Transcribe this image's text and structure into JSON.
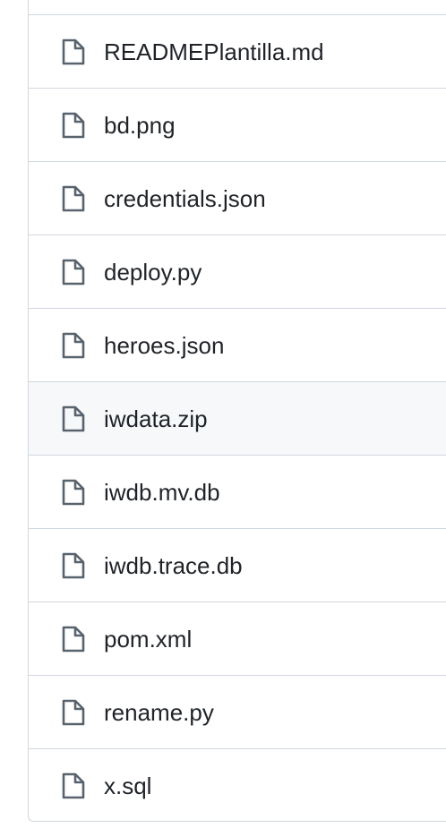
{
  "file_list": {
    "hovered_index": 5,
    "files": [
      {
        "name": "READMEPlantilla.md",
        "icon": "file-icon"
      },
      {
        "name": "bd.png",
        "icon": "file-icon"
      },
      {
        "name": "credentials.json",
        "icon": "file-icon"
      },
      {
        "name": "deploy.py",
        "icon": "file-icon"
      },
      {
        "name": "heroes.json",
        "icon": "file-icon"
      },
      {
        "name": "iwdata.zip",
        "icon": "file-icon"
      },
      {
        "name": "iwdb.mv.db",
        "icon": "file-icon"
      },
      {
        "name": "iwdb.trace.db",
        "icon": "file-icon"
      },
      {
        "name": "pom.xml",
        "icon": "file-icon"
      },
      {
        "name": "rename.py",
        "icon": "file-icon"
      },
      {
        "name": "x.sql",
        "icon": "file-icon"
      }
    ]
  },
  "colors": {
    "border": "#d0d7de",
    "icon": "#59636e",
    "text": "#1f2328",
    "hover_bg": "#f6f8fa"
  }
}
